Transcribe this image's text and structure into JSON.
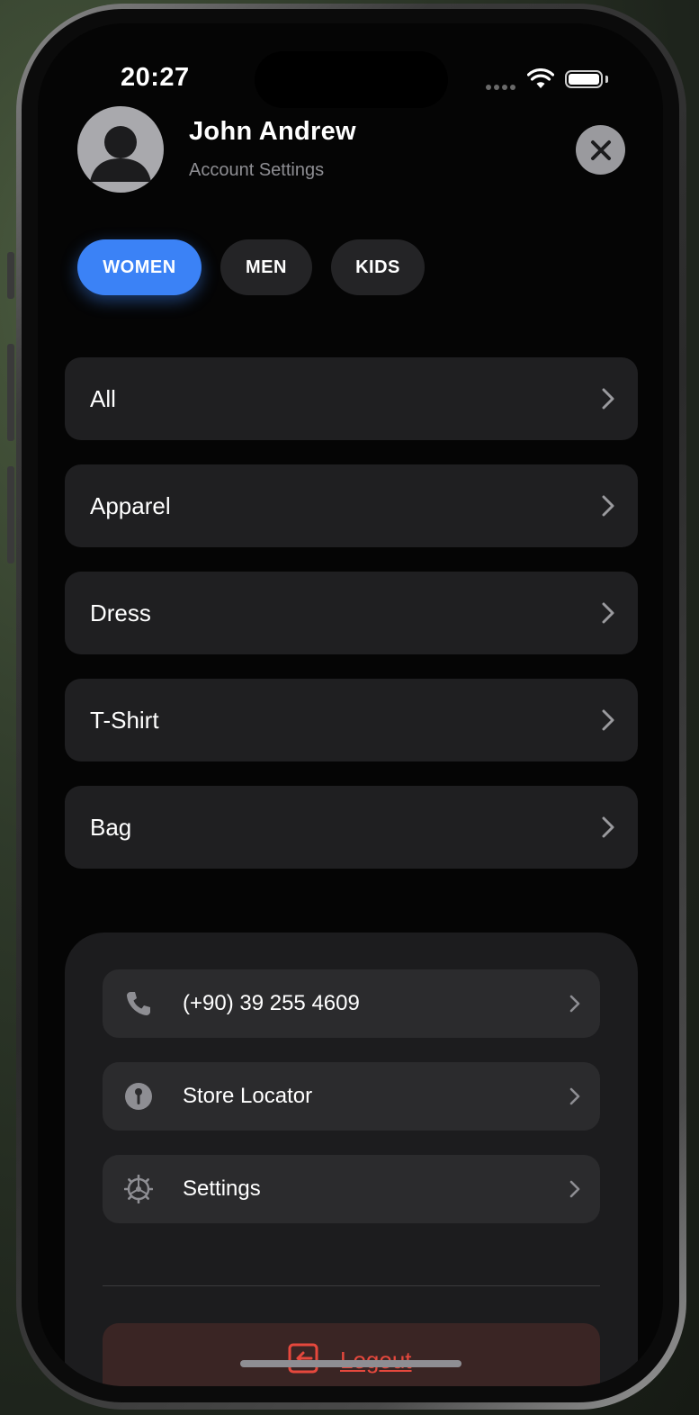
{
  "status_bar": {
    "time": "20:27"
  },
  "profile": {
    "name": "John  Andrew",
    "subtitle": "Account Settings"
  },
  "segments": [
    {
      "label": "WOMEN",
      "active": true
    },
    {
      "label": "MEN",
      "active": false
    },
    {
      "label": "KIDS",
      "active": false
    }
  ],
  "categories": [
    "All",
    "Apparel",
    "Dress",
    "T-Shirt",
    "Bag"
  ],
  "menu": {
    "phone": "(+90) 39 255 4609",
    "store_locator": "Store Locator",
    "settings": "Settings"
  },
  "logout_label": "Logout",
  "colors": {
    "accent": "#3b82f6",
    "logout": "#e5483d",
    "row_background": "#1f1f21",
    "card_background": "#1c1c1e"
  },
  "icons": {
    "avatar": "person-silhouette-icon",
    "close": "close-icon",
    "phone": "phone-icon",
    "store": "location-pin-icon",
    "settings": "gear-icon",
    "logout": "logout-icon",
    "chevron": "chevron-right-icon"
  }
}
